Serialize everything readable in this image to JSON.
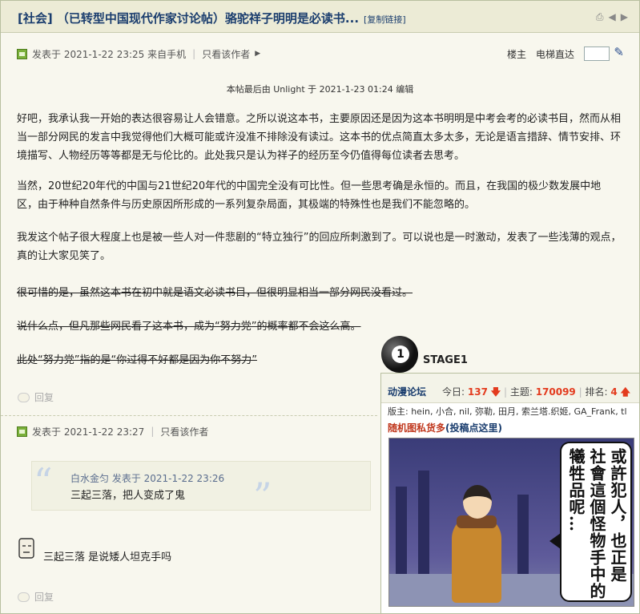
{
  "thread": {
    "title": "[社会] （已转型中国现代作家讨论帖）骆驼祥子明明是必读书...",
    "copy_link": "[复制链接]"
  },
  "post1": {
    "meta": "发表于 2021-1-22 23:25 来自手机",
    "only_author": "只看该作者",
    "floor_label": "楼主",
    "elevator_label": "电梯直达",
    "edited_note": "本帖最后由 Unlight 于 2021-1-23 01:24 编辑",
    "p1": "好吧，我承认我一开始的表达很容易让人会错意。之所以说这本书，主要原因还是因为这本书明明是中考会考的必读书目，然而从相当一部分网民的发言中我觉得他们大概可能或许没准不排除没有读过。这本书的优点简直太多太多，无论是语言措辞、情节安排、环境描写、人物经历等等都是无与伦比的。此处我只是认为祥子的经历至今仍值得每位读者去思考。",
    "p2": "当然，20世纪20年代的中国与21世纪20年代的中国完全没有可比性。但一些思考确是永恒的。而且，在我国的极少数发展中地区，由于种种自然条件与历史原因所形成的一系列复杂局面，其极端的特殊性也是我们不能忽略的。",
    "p3": "我发这个帖子很大程度上也是被一些人对一件悲剧的“特立独行”的回应所刺激到了。可以说也是一时激动，发表了一些浅薄的观点，真的让大家见笑了。",
    "s1": "很可惜的是，虽然这本书在初中就是语文必读书目，但很明显相当一部分网民没看过。",
    "s2": "说什么点，但凡那些网民看了这本书，成为“努力党”的概率都不会这么高。",
    "s3": "此处“努力党”指的是“你过得不好都是因为你不努力”",
    "reply": "回复"
  },
  "post2": {
    "meta": "发表于 2021-1-22 23:27",
    "only_author": "只看该作者",
    "quote_author": "白水金匀 发表于 2021-1-22 23:26",
    "quote_text": "三起三落，把人变成了鬼",
    "reply_text": "三起三落 是说矮人坦克手吗",
    "reply": "回复"
  },
  "ad": {
    "stage": "STAGE1",
    "stage_num": "1",
    "forum": "动漫论坛",
    "today_label": "今日:",
    "today_value": "137",
    "topics_label": "主题:",
    "topics_value": "170099",
    "rank_label": "排名:",
    "rank_value": "4",
    "moderators": "版主: hein, 小合, nil, 弥勒, 田月, 索兰塔.织姬, GA_Frank, tl",
    "random_label": "随机图私货多",
    "submit_label": "(投稿点这里)",
    "comic_text_col1": "或許犯人，也正是",
    "comic_text_col2": "社會這個怪物手中的",
    "comic_text_col3": "犧牲品呢…"
  }
}
